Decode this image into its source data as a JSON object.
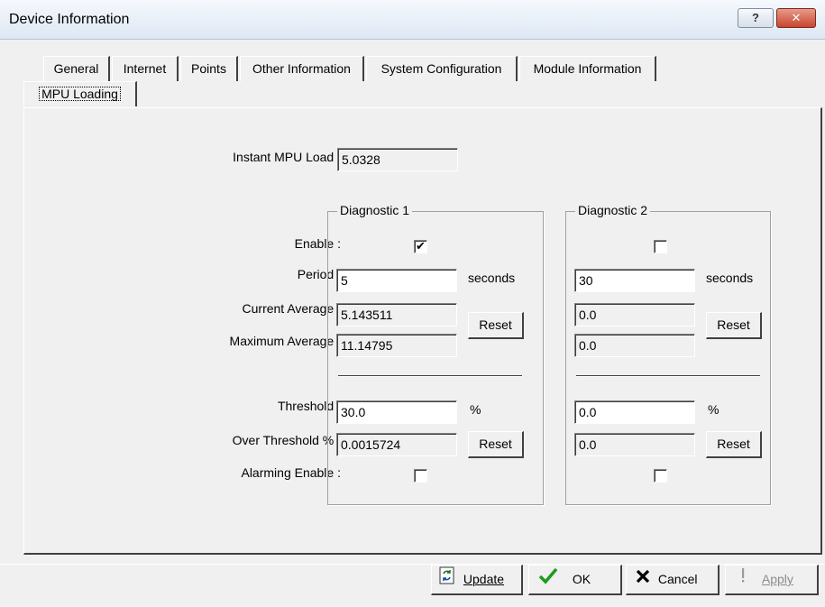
{
  "window": {
    "title": "Device Information",
    "help_glyph": "?",
    "close_glyph": "✕"
  },
  "tabs": {
    "row1": [
      "General",
      "Internet",
      "Points",
      "Other Information",
      "System Configuration",
      "Module Information"
    ],
    "active": "MPU Loading"
  },
  "instant": {
    "label": "Instant MPU Load :",
    "value": "5.0328"
  },
  "row_labels": {
    "enable": "Enable :",
    "period": "Period :",
    "current_average": "Current Average :",
    "maximum_average": "Maximum Average :",
    "threshold": "Threshold :",
    "over_threshold": "Over Threshold % :",
    "alarming_enable": "Alarming Enable :"
  },
  "diag1": {
    "title": "Diagnostic 1",
    "enable_checked": true,
    "period": "5",
    "period_unit": "seconds",
    "current_average": "5.143511",
    "maximum_average": "11.14795",
    "reset_label": "Reset",
    "threshold": "30.0",
    "threshold_unit": "%",
    "over_threshold": "0.0015724",
    "reset2_label": "Reset",
    "alarming_enable_checked": false
  },
  "diag2": {
    "title": "Diagnostic 2",
    "enable_checked": false,
    "period": "30",
    "period_unit": "seconds",
    "current_average": "0.0",
    "maximum_average": "0.0",
    "reset_label": "Reset",
    "threshold": "0.0",
    "threshold_unit": "%",
    "over_threshold": "0.0",
    "reset2_label": "Reset",
    "alarming_enable_checked": false
  },
  "footer": {
    "update_label": "Update",
    "ok_label": "OK",
    "cancel_label": "Cancel",
    "apply_label": "Apply",
    "apply_enabled": false,
    "icons": {
      "update": "refresh-document-icon",
      "ok": "green-check-icon",
      "cancel": "black-x-icon",
      "apply": "exclamation-icon"
    },
    "colors": {
      "ok": "#1f9a1f",
      "cancel": "#000000"
    }
  }
}
